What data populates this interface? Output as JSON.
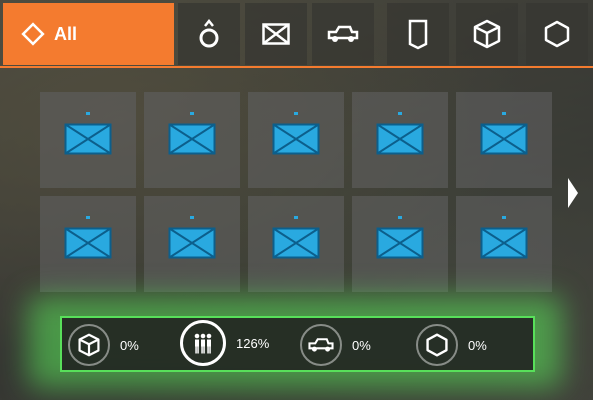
{
  "tabs": [
    {
      "id": "all",
      "label": "All",
      "icon": "diamond-icon",
      "selected": true
    },
    {
      "id": "infantry",
      "icon": "infantry-marker-icon"
    },
    {
      "id": "mail",
      "icon": "envelope-icon"
    },
    {
      "id": "vehicle",
      "icon": "vehicle-icon"
    },
    {
      "id": "shield",
      "icon": "shield-icon"
    },
    {
      "id": "supplies",
      "icon": "crate-icon"
    },
    {
      "id": "hexagon",
      "icon": "hexagon-icon"
    }
  ],
  "grid": {
    "rows": 2,
    "columns": 5,
    "item_icon": "envelope-icon",
    "item_count": 10
  },
  "summary": [
    {
      "icon": "crate-icon",
      "value": "0%"
    },
    {
      "icon": "people-icon",
      "value": "126%",
      "active": true
    },
    {
      "icon": "vehicle-icon",
      "value": "0%"
    },
    {
      "icon": "hexagon-icon",
      "value": "0%"
    }
  ],
  "colors": {
    "accent": "#f47b2f",
    "envelope": "#29a9e0",
    "highlight": "#58e05a"
  }
}
